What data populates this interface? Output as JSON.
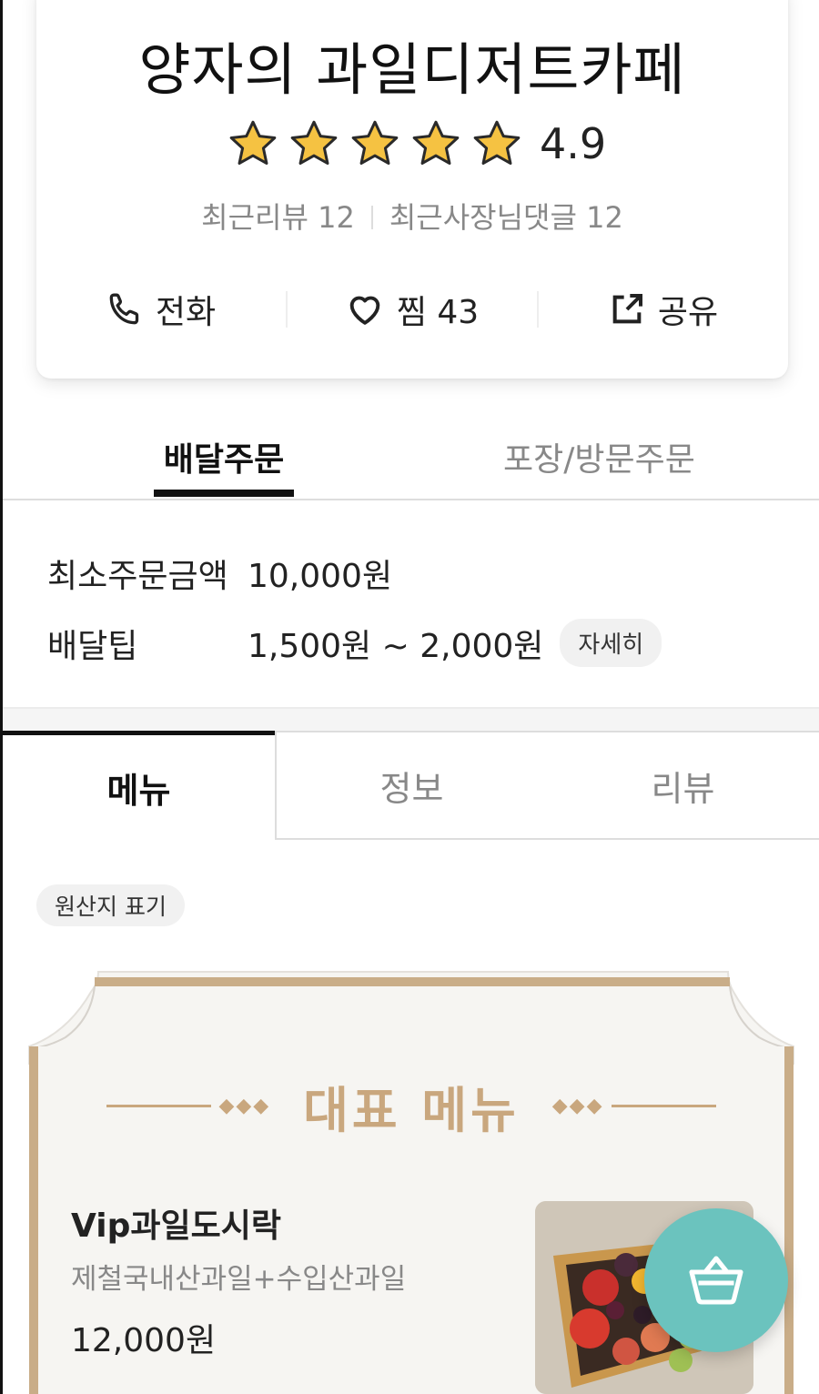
{
  "store": {
    "name": "양자의 과일디저트카페",
    "rating": "4.9",
    "stars": 5,
    "recent_reviews": "최근리뷰 12",
    "owner_comments": "최근사장님댓글 12"
  },
  "actions": {
    "call_label": "전화",
    "like_label": "찜 43",
    "share_label": "공유"
  },
  "order_tabs": {
    "delivery": "배달주문",
    "pickup": "포장/방문주문"
  },
  "delivery_info": {
    "min_order_label": "최소주문금액",
    "min_order_value": "10,000원",
    "tip_label": "배달팁",
    "tip_value": "1,500원 ~ 2,000원",
    "detail_button": "자세히"
  },
  "main_tabs": {
    "menu": "메뉴",
    "info": "정보",
    "review": "리뷰"
  },
  "origin_chip": "원산지 표기",
  "rep_menu": {
    "heading": "대표 메뉴",
    "item": {
      "name": "Vip과일도시락",
      "description": "제철국내산과일+수입산과일",
      "price": "12,000원"
    }
  },
  "colors": {
    "accent_mint": "#6bc3be",
    "gold": "#c9a77e",
    "star": "#f5c242"
  },
  "icons": [
    "phone-icon",
    "heart-icon",
    "share-icon",
    "cart-icon",
    "star-icon"
  ]
}
